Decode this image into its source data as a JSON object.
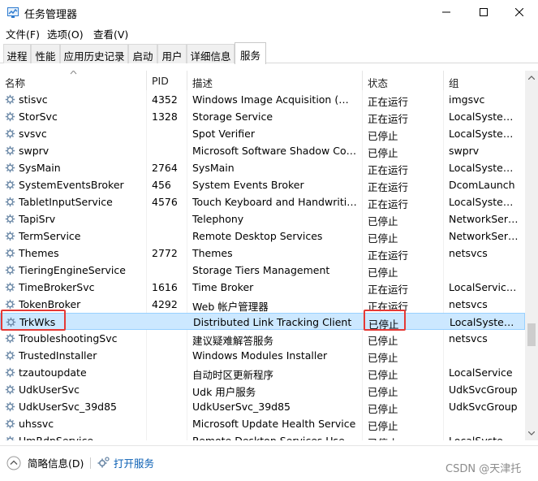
{
  "window": {
    "title": "任务管理器"
  },
  "menu": [
    "文件(F)",
    "选项(O)",
    "查看(V)"
  ],
  "tabs": [
    "进程",
    "性能",
    "应用历史记录",
    "启动",
    "用户",
    "详细信息",
    "服务"
  ],
  "columns": {
    "name": "名称",
    "pid": "PID",
    "desc": "描述",
    "status": "状态",
    "group": "组"
  },
  "rows": [
    {
      "name": "stisvc",
      "pid": "4352",
      "desc": "Windows Image Acquisition (WIA)",
      "status": "正在运行",
      "group": "imgsvc"
    },
    {
      "name": "StorSvc",
      "pid": "1328",
      "desc": "Storage Service",
      "status": "正在运行",
      "group": "LocalSystem..."
    },
    {
      "name": "svsvc",
      "pid": "",
      "desc": "Spot Verifier",
      "status": "已停止",
      "group": "LocalSystem..."
    },
    {
      "name": "swprv",
      "pid": "",
      "desc": "Microsoft Software Shadow Cop...",
      "status": "已停止",
      "group": "swprv"
    },
    {
      "name": "SysMain",
      "pid": "2764",
      "desc": "SysMain",
      "status": "正在运行",
      "group": "LocalSystem..."
    },
    {
      "name": "SystemEventsBroker",
      "pid": "456",
      "desc": "System Events Broker",
      "status": "正在运行",
      "group": "DcomLaunch"
    },
    {
      "name": "TabletInputService",
      "pid": "4576",
      "desc": "Touch Keyboard and Handwritin...",
      "status": "正在运行",
      "group": "LocalSystem..."
    },
    {
      "name": "TapiSrv",
      "pid": "",
      "desc": "Telephony",
      "status": "已停止",
      "group": "NetworkServ..."
    },
    {
      "name": "TermService",
      "pid": "",
      "desc": "Remote Desktop Services",
      "status": "已停止",
      "group": "NetworkServ..."
    },
    {
      "name": "Themes",
      "pid": "2772",
      "desc": "Themes",
      "status": "正在运行",
      "group": "netsvcs"
    },
    {
      "name": "TieringEngineService",
      "pid": "",
      "desc": "Storage Tiers Management",
      "status": "已停止",
      "group": ""
    },
    {
      "name": "TimeBrokerSvc",
      "pid": "1616",
      "desc": "Time Broker",
      "status": "正在运行",
      "group": "LocalService..."
    },
    {
      "name": "TokenBroker",
      "pid": "4292",
      "desc": "Web 帐户管理器",
      "status": "正在运行",
      "group": "netsvcs"
    },
    {
      "name": "TrkWks",
      "pid": "",
      "desc": "Distributed Link Tracking Client",
      "status": "已停止",
      "group": "LocalSystem..."
    },
    {
      "name": "TroubleshootingSvc",
      "pid": "",
      "desc": "建议疑难解答服务",
      "status": "已停止",
      "group": "netsvcs"
    },
    {
      "name": "TrustedInstaller",
      "pid": "",
      "desc": "Windows Modules Installer",
      "status": "已停止",
      "group": ""
    },
    {
      "name": "tzautoupdate",
      "pid": "",
      "desc": "自动时区更新程序",
      "status": "已停止",
      "group": "LocalService"
    },
    {
      "name": "UdkUserSvc",
      "pid": "",
      "desc": "Udk 用户服务",
      "status": "已停止",
      "group": "UdkSvcGroup"
    },
    {
      "name": "UdkUserSvc_39d85",
      "pid": "",
      "desc": "UdkUserSvc_39d85",
      "status": "已停止",
      "group": "UdkSvcGroup"
    },
    {
      "name": "uhssvc",
      "pid": "",
      "desc": "Microsoft Update Health Service",
      "status": "已停止",
      "group": ""
    },
    {
      "name": "UmRdpService",
      "pid": "",
      "desc": "Remote Desktop Services UserM...",
      "status": "已停止",
      "group": "LocalSystem..."
    }
  ],
  "selected_row": 13,
  "footer": {
    "less_details": "简略信息(D)",
    "open_services": "打开服务"
  },
  "watermark": "CSDN @天津托",
  "colors": {
    "selection": "#cce8ff",
    "highlight": "#e53935",
    "link": "#0a5fb4"
  }
}
